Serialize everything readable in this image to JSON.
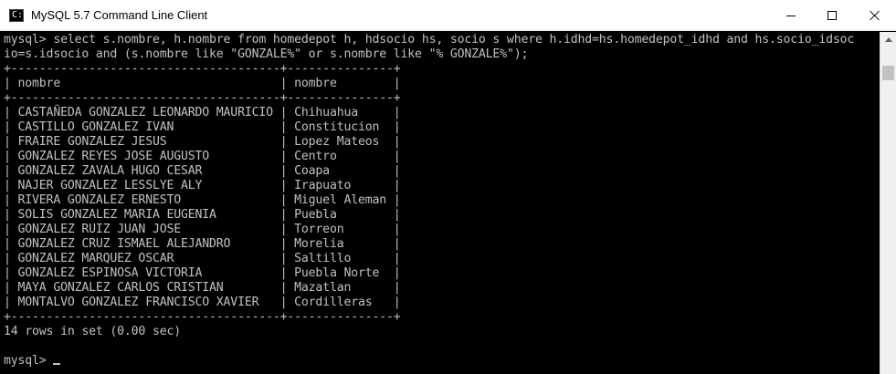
{
  "window": {
    "title": "MySQL 5.7 Command Line Client",
    "icon_glyph": "C:\\"
  },
  "console": {
    "prompt": "mysql>",
    "query_line1": "select s.nombre, h.nombre from homedepot h, hdsocio hs, socio s where h.idhd=hs.homedepot_idhd and hs.socio_idsoc",
    "query_line2": "io=s.idsocio and (s.nombre like \"GONZALE%\" or s.nombre like \"% GONZALE%\");",
    "columns": [
      "nombre",
      "nombre"
    ],
    "rows": [
      [
        "CASTAÑEDA GONZALEZ LEONARDO MAURICIO",
        "Chihuahua"
      ],
      [
        "CASTILLO GONZALEZ IVAN",
        "Constitucion"
      ],
      [
        "FRAIRE GONZALEZ JESUS",
        "Lopez Mateos"
      ],
      [
        "GONZALEZ REYES JOSE AUGUSTO",
        "Centro"
      ],
      [
        "GONZALEZ ZAVALA HUGO CESAR",
        "Coapa"
      ],
      [
        "NAJER GONZALEZ LESSLYE ALY",
        "Irapuato"
      ],
      [
        "RIVERA GONZALEZ ERNESTO",
        "Miguel Aleman"
      ],
      [
        "SOLIS GONZALEZ MARIA EUGENIA",
        "Puebla"
      ],
      [
        "GONZALEZ RUIZ JUAN JOSE",
        "Torreon"
      ],
      [
        "GONZALEZ CRUZ ISMAEL ALEJANDRO",
        "Morelia"
      ],
      [
        "GONZALEZ MARQUEZ OSCAR",
        "Saltillo"
      ],
      [
        "GONZALEZ ESPINOSA VICTORIA",
        "Puebla Norte"
      ],
      [
        "MAYA GONZALEZ CARLOS CRISTIAN",
        "Mazatlan"
      ],
      [
        "MONTALVO GONZALEZ FRANCISCO XAVIER",
        "Cordilleras"
      ]
    ],
    "result_summary": "14 rows in set (0.00 sec)",
    "final_prompt": "mysql> "
  },
  "icons": {
    "app": "console-icon",
    "minimize": "minimize-icon",
    "maximize": "maximize-icon",
    "close": "close-icon",
    "scroll_up": "scroll-up-arrow-icon"
  },
  "colors": {
    "console_bg": "#000000",
    "console_text": "#c0c0c0",
    "titlebar_bg": "#ffffff"
  }
}
